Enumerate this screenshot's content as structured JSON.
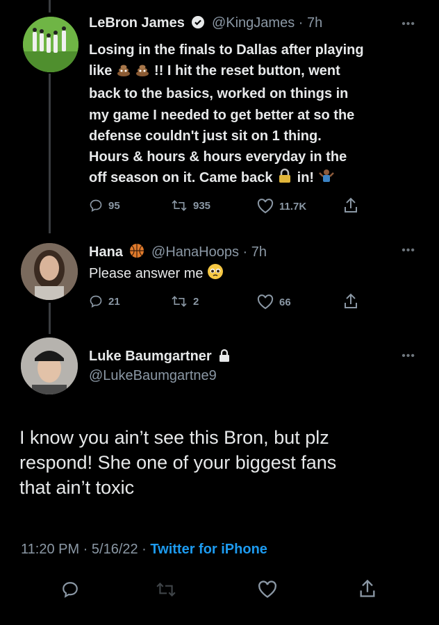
{
  "tweet1": {
    "name": "LeBron James",
    "handle": "@KingJames",
    "time": "· 7h",
    "lines": [
      "Losing in the finals to Dallas after playing",
      "!! I hit the reset button, went",
      "back to the basics, worked on things in",
      "my game I needed to get better at so the",
      "defense couldn't just sit on 1 thing.",
      "Hours & hours & hours everyday in the",
      "off season on it. Came back",
      "in!"
    ],
    "line2_prefix": "like",
    "replies": "95",
    "retweets": "935",
    "likes": "11.7K"
  },
  "tweet2": {
    "name": "Hana",
    "handle": "@HanaHoops",
    "time": "· 7h",
    "text": "Please answer me",
    "replies": "21",
    "retweets": "2",
    "likes": "66"
  },
  "tweet3": {
    "name": "Luke Baumgartner",
    "handle": "@LukeBaumgartne9",
    "lines": [
      "I know you ain’t see this Bron, but plz",
      "respond! She one of your biggest fans",
      "that ain’t toxic"
    ],
    "timestamp": "11:20 PM · 5/16/22 · ",
    "source": "Twitter for iPhone"
  },
  "icons": {
    "reply": "reply-icon",
    "retweet": "retweet-icon",
    "like": "heart-icon",
    "share": "share-icon",
    "more": "more-icon"
  },
  "colors": {
    "background": "#000000",
    "text": "#e7e9ea",
    "muted": "#8b98a5",
    "link": "#1d9bf0"
  }
}
